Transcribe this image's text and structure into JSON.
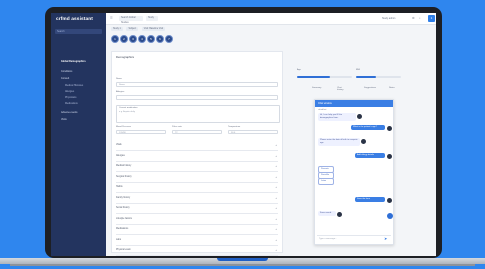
{
  "app": {
    "logo": "crfmd assistant",
    "sidebar_search": "Search",
    "sidebar_items": [
      {
        "label": "Global Demographics",
        "sub": false,
        "active": true
      },
      {
        "label": "Conditions",
        "sub": false,
        "active": false
      },
      {
        "label": "Consult",
        "sub": false,
        "active": false
      },
      {
        "label": "Medical Histories",
        "sub": true,
        "active": false
      },
      {
        "label": "Allergies",
        "sub": true,
        "active": false
      },
      {
        "label": "Physicians",
        "sub": true,
        "active": false
      },
      {
        "label": "Medications",
        "sub": true,
        "active": false
      },
      {
        "label": "Adverse events",
        "sub": false,
        "active": false
      },
      {
        "label": "Visits",
        "sub": false,
        "active": false
      }
    ]
  },
  "topbar": {
    "menu_icon": "menu-icon",
    "search_placeholder": "Search Global Studies",
    "search_value": "Study",
    "badge": "1",
    "user_name": "Study admin",
    "icons": [
      "bell-icon",
      "gear-icon"
    ]
  },
  "breadcrumb": [
    "Study 1",
    "Subject",
    "Visit: Baseline Visit"
  ],
  "stepper": {
    "steps": [
      "1",
      "2",
      "3",
      "4",
      "5",
      "6",
      "7"
    ]
  },
  "form": {
    "title": "Demographics",
    "fields": [
      {
        "label": "Name",
        "placeholder": "Name"
      },
      {
        "label": "Allergies",
        "placeholder": ""
      }
    ],
    "note_label": "Current medication",
    "note_text": "e.g. Aspirin daily",
    "small_fields": [
      {
        "label": "Blood Pressure",
        "value": "120/80"
      },
      {
        "label": "Pulse rate",
        "value": "72"
      },
      {
        "label": "Temperature",
        "value": "36.6"
      }
    ],
    "sections": [
      "Vitals",
      "Allergies",
      "Medical history",
      "Surgical history",
      "Habits",
      "Family history",
      "Social history",
      "Lifestyle factors",
      "Medications",
      "Labs",
      "Physical exam"
    ]
  },
  "right_panel": {
    "sliders": [
      {
        "label": "Age",
        "value_pct": 60
      },
      {
        "label": "BMI",
        "value_pct": 45
      }
    ],
    "tabs": [
      "Summary",
      "Chat history",
      "Suggestions",
      "Notes"
    ]
  },
  "chat": {
    "title": "Chat window",
    "bot_name": "crfmd bot",
    "messages": [
      {
        "from": "bot",
        "text": "Hi, I can help you fill the demographics form."
      },
      {
        "from": "user",
        "text": "What is the patient's age?"
      },
      {
        "from": "bot",
        "text": "Please enter the date of birth to compute age."
      },
      {
        "from": "user",
        "text": "Add allergy details"
      },
      {
        "from": "opt",
        "text": "Peanuts"
      },
      {
        "from": "opt",
        "text": "Penicillin"
      },
      {
        "from": "opt",
        "text": "Latex"
      },
      {
        "from": "user",
        "text": "Save the form"
      },
      {
        "from": "bot",
        "text": "Form saved."
      }
    ],
    "input_placeholder": "Type a message...",
    "send_icon": "send-icon"
  }
}
